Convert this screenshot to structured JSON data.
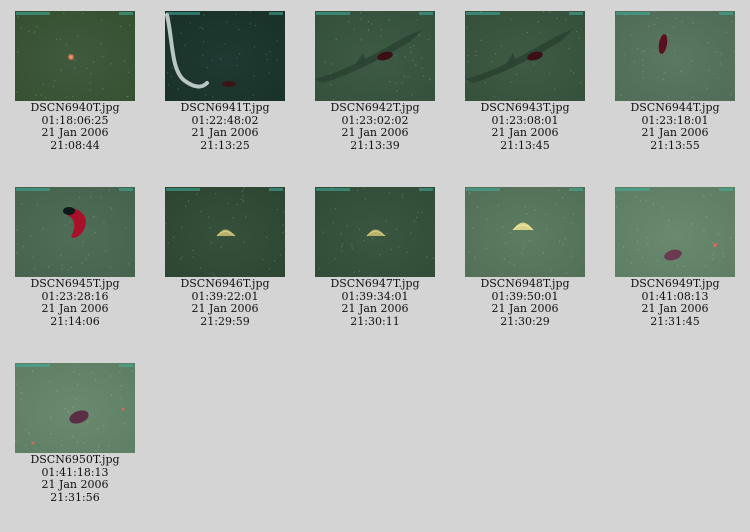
{
  "thumbnails": [
    {
      "filename": "DSCN6940T.jpg",
      "elapsed": "01:18:06:25",
      "date": "21 Jan 2006",
      "time": "21:08:44",
      "image": {
        "bg": "#3f5a3e",
        "bg2": "#34502f",
        "subject": "small-starfish",
        "description": "seafloor with small orange organism"
      }
    },
    {
      "filename": "DSCN6941T.jpg",
      "elapsed": "01:22:48:02",
      "date": "21 Jan 2006",
      "time": "21:13:25",
      "image": {
        "bg": "#1f3a32",
        "bg2": "#183028",
        "subject": "eel",
        "description": "dark seafloor with eel and sea cucumber"
      }
    },
    {
      "filename": "DSCN6942T.jpg",
      "elapsed": "01:23:02:02",
      "date": "21 Jan 2006",
      "time": "21:13:39",
      "image": {
        "bg": "#3d5a45",
        "bg2": "#33503b",
        "subject": "shark",
        "description": "shark shadow and sea cucumber"
      }
    },
    {
      "filename": "DSCN6943T.jpg",
      "elapsed": "01:23:08:01",
      "date": "21 Jan 2006",
      "time": "21:13:45",
      "image": {
        "bg": "#3e5b44",
        "bg2": "#34503a",
        "subject": "shark",
        "description": "shark shadow and sea cucumber"
      }
    },
    {
      "filename": "DSCN6944T.jpg",
      "elapsed": "01:23:18:01",
      "date": "21 Jan 2006",
      "time": "21:13:55",
      "image": {
        "bg": "#5a7862",
        "bg2": "#4d6b55",
        "subject": "sea-cucumber-upright",
        "description": "sea cucumber on sediment"
      }
    },
    {
      "filename": "DSCN6945T.jpg",
      "elapsed": "01:23:28:16",
      "date": "21 Jan 2006",
      "time": "21:14:06",
      "image": {
        "bg": "#4f6e57",
        "bg2": "#44624c",
        "subject": "red-cucumber",
        "description": "red sea cucumber"
      }
    },
    {
      "filename": "DSCN6946T.jpg",
      "elapsed": "01:39:22:01",
      "date": "21 Jan 2006",
      "time": "21:29:59",
      "image": {
        "bg": "#35503b",
        "bg2": "#2c4532",
        "subject": "urchin",
        "description": "heart urchin on seafloor"
      }
    },
    {
      "filename": "DSCN6947T.jpg",
      "elapsed": "01:39:34:01",
      "date": "21 Jan 2006",
      "time": "21:30:11",
      "image": {
        "bg": "#3a5640",
        "bg2": "#304b36",
        "subject": "urchin",
        "description": "heart urchin on seafloor"
      }
    },
    {
      "filename": "DSCN6948T.jpg",
      "elapsed": "01:39:50:01",
      "date": "21 Jan 2006",
      "time": "21:30:29",
      "image": {
        "bg": "#5d7d63",
        "bg2": "#506f56",
        "subject": "urchin-bright",
        "description": "heart urchin on lighter sediment"
      }
    },
    {
      "filename": "DSCN6949T.jpg",
      "elapsed": "01:41:08:13",
      "date": "21 Jan 2006",
      "time": "21:31:45",
      "image": {
        "bg": "#6a8a70",
        "bg2": "#5d7d63",
        "subject": "purple-cucumber",
        "description": "purple sea cucumber on sediment"
      }
    },
    {
      "filename": "DSCN6950T.jpg",
      "elapsed": "01:41:18:13",
      "date": "21 Jan 2006",
      "time": "21:31:56",
      "image": {
        "bg": "#6a8a70",
        "bg2": "#5e7e64",
        "subject": "purple-cucumber-2",
        "description": "purple sea cucumber on sediment"
      }
    }
  ]
}
